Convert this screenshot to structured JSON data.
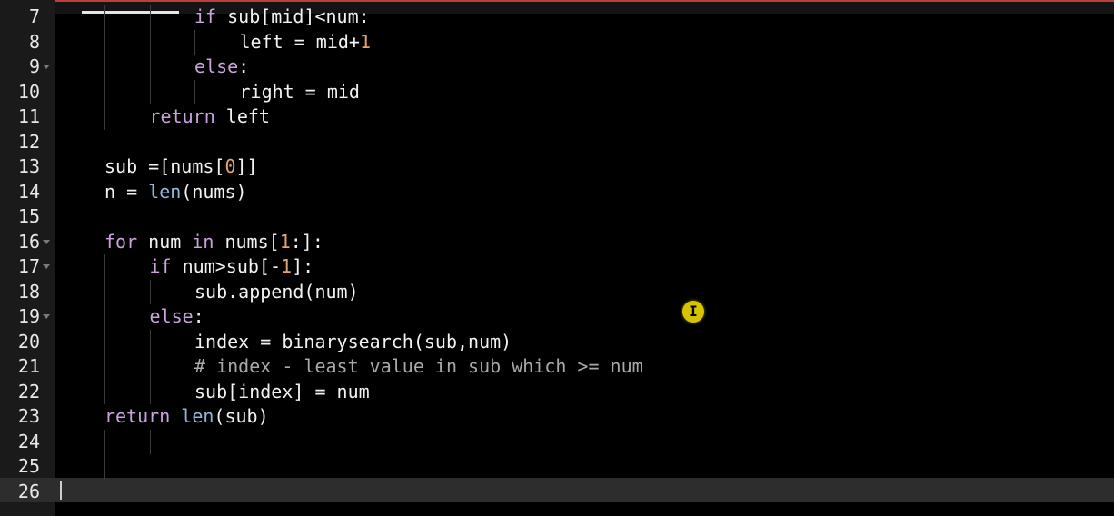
{
  "editor": {
    "lines": [
      {
        "number": "7",
        "tokens": [
          {
            "t": "if",
            "c": "kw"
          },
          {
            "t": " sub[mid]<num:",
            "c": "op"
          }
        ]
      },
      {
        "number": "8",
        "tokens": [
          {
            "t": "left = mid+",
            "c": "op"
          },
          {
            "t": "1",
            "c": "num"
          }
        ]
      },
      {
        "number": "9",
        "tokens": [
          {
            "t": "else",
            "c": "kw"
          },
          {
            "t": ":",
            "c": "op"
          }
        ]
      },
      {
        "number": "10",
        "tokens": [
          {
            "t": "right = mid",
            "c": "op"
          }
        ]
      },
      {
        "number": "11",
        "tokens": [
          {
            "t": "return",
            "c": "kw"
          },
          {
            "t": " left",
            "c": "op"
          }
        ]
      },
      {
        "number": "12",
        "tokens": []
      },
      {
        "number": "13",
        "tokens": [
          {
            "t": "sub =[nums[",
            "c": "op"
          },
          {
            "t": "0",
            "c": "num"
          },
          {
            "t": "]]",
            "c": "op"
          }
        ]
      },
      {
        "number": "14",
        "tokens": [
          {
            "t": "n = ",
            "c": "op"
          },
          {
            "t": "len",
            "c": "fn"
          },
          {
            "t": "(nums)",
            "c": "op"
          }
        ]
      },
      {
        "number": "15",
        "tokens": []
      },
      {
        "number": "16",
        "tokens": [
          {
            "t": "for",
            "c": "kw"
          },
          {
            "t": " num ",
            "c": "op"
          },
          {
            "t": "in",
            "c": "kw"
          },
          {
            "t": " nums[",
            "c": "op"
          },
          {
            "t": "1",
            "c": "num"
          },
          {
            "t": ":]:",
            "c": "op"
          }
        ]
      },
      {
        "number": "17",
        "tokens": [
          {
            "t": "if",
            "c": "kw"
          },
          {
            "t": " num>sub[-",
            "c": "op"
          },
          {
            "t": "1",
            "c": "num"
          },
          {
            "t": "]:",
            "c": "op"
          }
        ]
      },
      {
        "number": "18",
        "tokens": [
          {
            "t": "sub.append(num)",
            "c": "op"
          }
        ]
      },
      {
        "number": "19",
        "tokens": [
          {
            "t": "else",
            "c": "kw"
          },
          {
            "t": ":",
            "c": "op"
          }
        ]
      },
      {
        "number": "20",
        "tokens": [
          {
            "t": "index = binarysearch(sub,num)",
            "c": "op"
          }
        ]
      },
      {
        "number": "21",
        "tokens": [
          {
            "t": "# index - least value in sub which >= num",
            "c": "cm"
          }
        ]
      },
      {
        "number": "22",
        "tokens": [
          {
            "t": "sub[index] = num",
            "c": "op"
          }
        ]
      },
      {
        "number": "23",
        "tokens": [
          {
            "t": "return",
            "c": "kw"
          },
          {
            "t": " ",
            "c": "op"
          },
          {
            "t": "len",
            "c": "fn"
          },
          {
            "t": "(sub)",
            "c": "op"
          }
        ]
      },
      {
        "number": "24",
        "tokens": []
      },
      {
        "number": "25",
        "tokens": []
      },
      {
        "number": "26",
        "tokens": []
      }
    ],
    "foldable_lines": [
      "9",
      "16",
      "17",
      "19"
    ],
    "colors": {
      "keyword": "#c9a3e0",
      "builtin": "#8fb8de",
      "number": "#e8a36a",
      "comment": "#a9a9a9",
      "text": "#f2f2f2",
      "background": "#000000",
      "gutter": "#1a1a1a",
      "active_line": "#2d2d2d",
      "cursor_highlight": "#d8c300"
    },
    "cursor_icon": "i-beam-cursor-icon"
  }
}
